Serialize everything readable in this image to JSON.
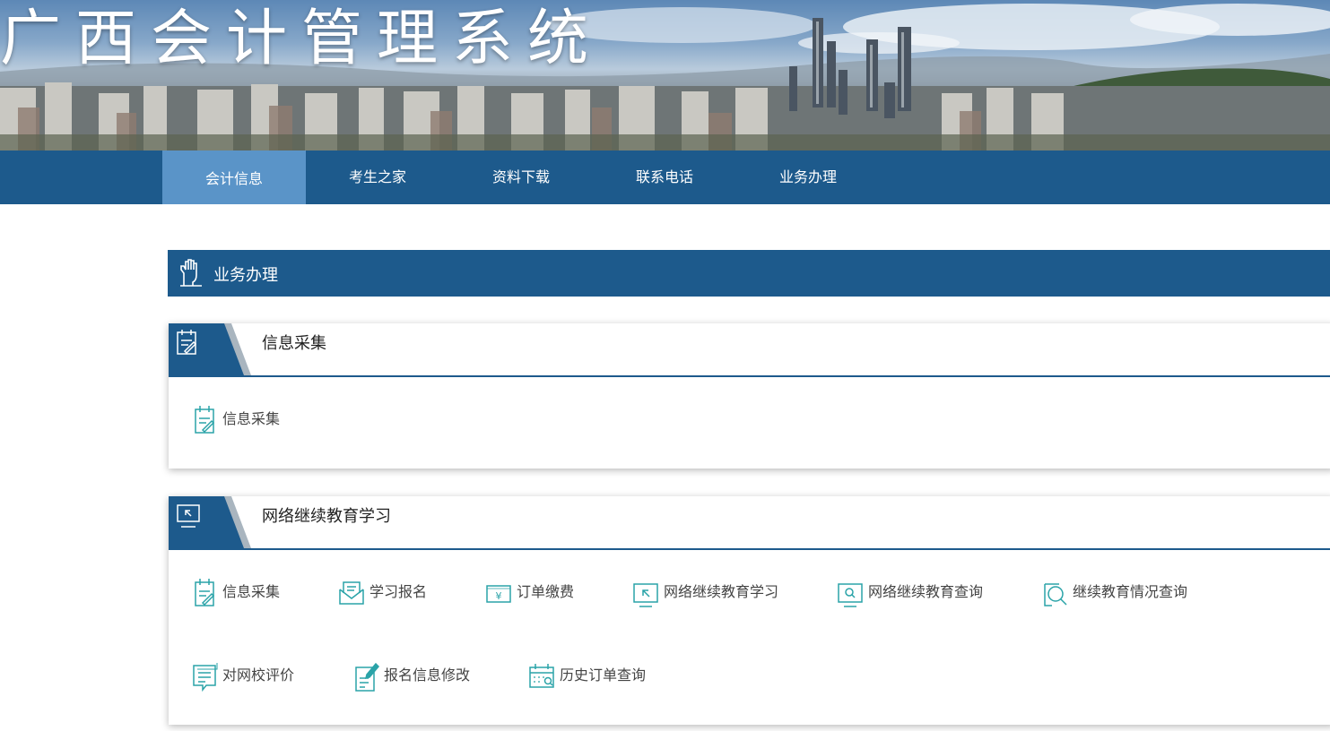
{
  "header": {
    "site_title": "广西会计管理系统"
  },
  "nav": {
    "items": [
      {
        "label": "会计信息",
        "active": true
      },
      {
        "label": "考生之家",
        "active": false
      },
      {
        "label": "资料下载",
        "active": false
      },
      {
        "label": "联系电话",
        "active": false
      },
      {
        "label": "业务办理",
        "active": false
      }
    ]
  },
  "section": {
    "title": "业务办理"
  },
  "panels": [
    {
      "title": "信息采集",
      "items": [
        {
          "label": "信息采集",
          "icon": "clipboard-edit-icon"
        }
      ]
    },
    {
      "title": "网络继续教育学习",
      "items": [
        {
          "label": "信息采集",
          "icon": "clipboard-edit-icon"
        },
        {
          "label": "学习报名",
          "icon": "envelope-icon"
        },
        {
          "label": "订单缴费",
          "icon": "yuan-card-icon"
        },
        {
          "label": "网络继续教育学习",
          "icon": "monitor-arrow-icon"
        },
        {
          "label": "网络继续教育查询",
          "icon": "monitor-search-icon"
        },
        {
          "label": "继续教育情况查询",
          "icon": "magnifier-icon"
        },
        {
          "label": "对网校评价",
          "icon": "comment-icon"
        },
        {
          "label": "报名信息修改",
          "icon": "document-edit-icon"
        },
        {
          "label": "历史订单查询",
          "icon": "calendar-search-icon"
        }
      ]
    }
  ],
  "colors": {
    "brand": "#1d5a8c",
    "nav_active": "#5a94c8",
    "icon_teal": "#2aa3a8"
  }
}
